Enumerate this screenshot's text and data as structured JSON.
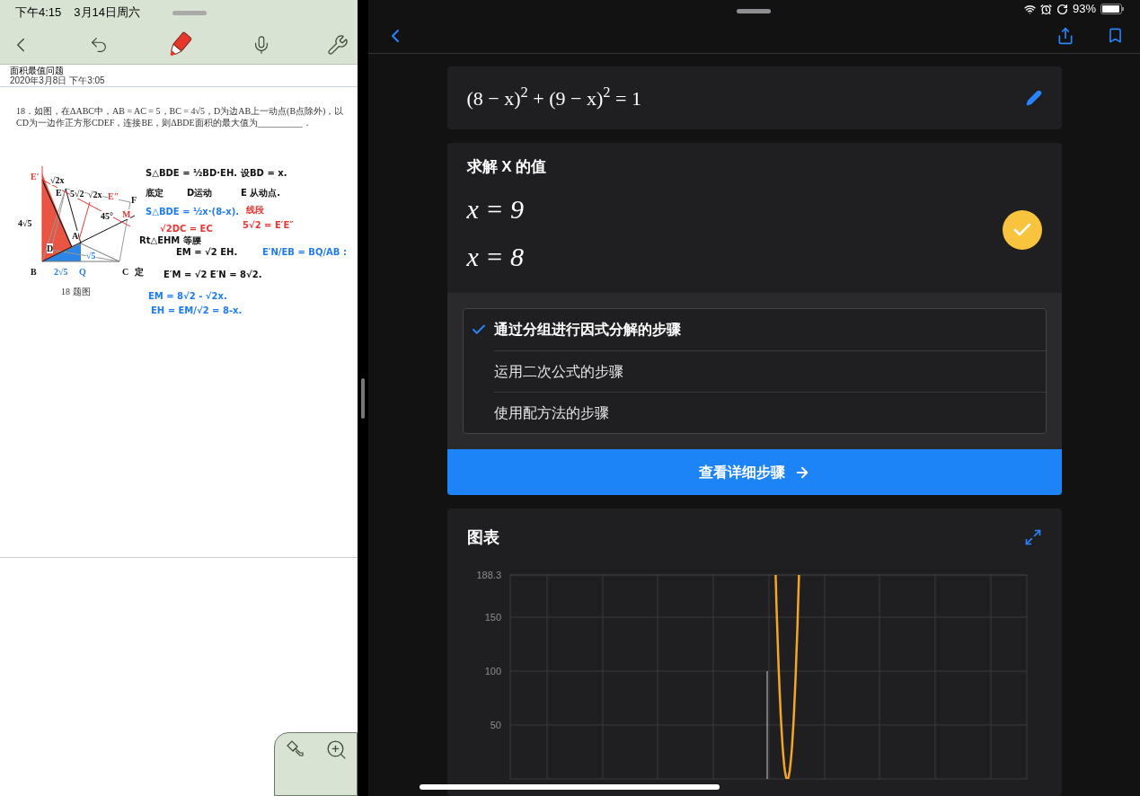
{
  "left_pane": {
    "status_bar": {
      "time": "下午4:15",
      "date": "3月14日周六"
    },
    "note": {
      "title": "面积最值问题",
      "date": "2020年3月8日 下午3:05",
      "problem": "18．如图，在ΔABC中，AB = AC = 5，BC = 4√5，D为边AB上一动点(B点除外)，以CD为一边作正方形CDEF，连接BE，则ΔBDE面积的最大值为__________．",
      "figure_labels": [
        {
          "text": "E′",
          "color": "#e53935"
        },
        {
          "text": "√2x",
          "color": "#111111"
        },
        {
          "text": "E",
          "color": "#111111"
        },
        {
          "text": "5√2",
          "color": "#111111"
        },
        {
          "text": "√2x",
          "color": "#111111"
        },
        {
          "text": "E″",
          "color": "#e53935"
        },
        {
          "text": "F",
          "color": "#111111"
        },
        {
          "text": "4√5",
          "color": "#111111"
        },
        {
          "text": "45°",
          "color": "#111111"
        },
        {
          "text": "M",
          "color": "#e53935"
        },
        {
          "text": "A",
          "color": "#111111"
        },
        {
          "text": "D",
          "color": "#111111"
        },
        {
          "text": "√5",
          "color": "#1e7bf0"
        },
        {
          "text": "B",
          "color": "#111111"
        },
        {
          "text": "2√5",
          "color": "#1e7bf0"
        },
        {
          "text": "Q",
          "color": "#1e7bf0"
        },
        {
          "text": "C",
          "color": "#111111"
        },
        {
          "text": "定",
          "color": "#111111"
        }
      ],
      "figure_caption": "18 题图",
      "handwriting": [
        {
          "text": "S△BDE = ½BD·EH.",
          "color": "#111111"
        },
        {
          "text": "设BD = x.",
          "color": "#111111"
        },
        {
          "text": "底定",
          "color": "#111111"
        },
        {
          "text": "D运动",
          "color": "#111111"
        },
        {
          "text": "E 从动点.",
          "color": "#111111"
        },
        {
          "text": "S△BDE = ½x·(8-x).",
          "color": "#1e7bf0"
        },
        {
          "text": "线段",
          "color": "#e53935"
        },
        {
          "text": "5√2 = E′E″",
          "color": "#e53935"
        },
        {
          "text": "√2DC = EC",
          "color": "#e53935"
        },
        {
          "text": "Rt△EHM 等腰",
          "color": "#111111"
        },
        {
          "text": "EM = √2 EH.",
          "color": "#111111"
        },
        {
          "text": "E′N/EB = BQ/AB :",
          "color": "#1e7bf0"
        },
        {
          "text": "E′M = √2 E′N = 8√2.",
          "color": "#111111"
        },
        {
          "text": "EM = 8√2 - √2x.",
          "color": "#1e7bf0"
        },
        {
          "text": "EH = EM/√2 = 8-x.",
          "color": "#1e7bf0"
        }
      ]
    }
  },
  "right_pane": {
    "status_bar": {
      "battery": "93%"
    },
    "equation": "(8 − x)$^{2}$ + (9 − x)$^{2}$ = 1",
    "solution": {
      "title": "求解 X 的值",
      "answers": [
        "x = 9",
        "x = 8"
      ],
      "verified": true
    },
    "methods": [
      {
        "label": "通过分组进行因式分解的步骤",
        "selected": true
      },
      {
        "label": "运用二次公式的步骤",
        "selected": false
      },
      {
        "label": "使用配方法的步骤",
        "selected": false
      }
    ],
    "details_button": "查看详细步骤",
    "graph": {
      "title": "图表",
      "y_axis_labels": [
        "188.3",
        "150",
        "100",
        "50"
      ]
    }
  }
}
